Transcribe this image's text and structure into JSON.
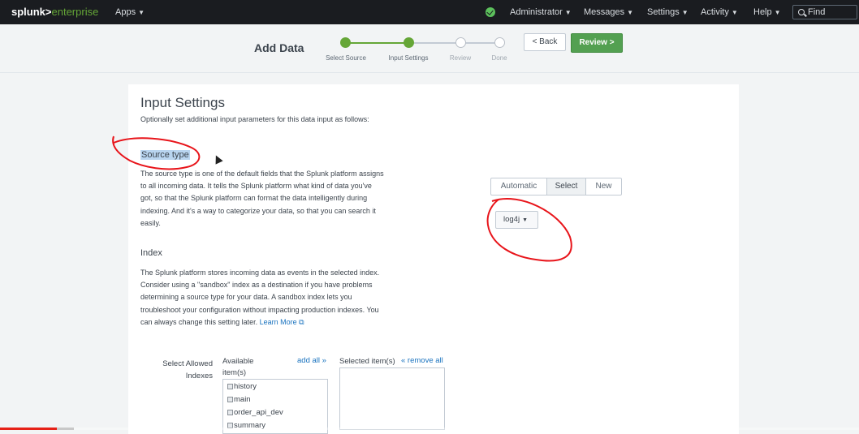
{
  "topbar": {
    "logo_main": "splunk>",
    "logo_sub": "enterprise",
    "apps": "Apps",
    "menu": [
      "Administrator",
      "Messages",
      "Settings",
      "Activity",
      "Help"
    ],
    "find_placeholder": "Find"
  },
  "wizard": {
    "title": "Add Data",
    "steps": [
      {
        "label": "Select Source",
        "state": "done"
      },
      {
        "label": "Input Settings",
        "state": "done"
      },
      {
        "label": "Review",
        "state": "todo"
      },
      {
        "label": "Done",
        "state": "todo"
      }
    ],
    "back_label": "< Back",
    "review_label": "Review >"
  },
  "main": {
    "heading": "Input Settings",
    "subheading": "Optionally set additional input parameters for this data input as follows:",
    "source_type": {
      "heading": "Source type",
      "description": "The source type is one of the default fields that the Splunk platform assigns to all incoming data. It tells the Splunk platform what kind of data you've got, so that the Splunk platform can format the data intelligently during indexing. And it's a way to categorize your data, so that you can search it easily.",
      "modes": [
        "Automatic",
        "Select",
        "New"
      ],
      "active_mode": "Select",
      "selected_value": "log4j"
    },
    "index": {
      "heading": "Index",
      "description": "The Splunk platform stores incoming data as events in the selected index. Consider using a \"sandbox\" index as a destination if you have problems determining a source type for your data. A sandbox index lets you troubleshoot your configuration without impacting production indexes. You can always change this setting later.",
      "learn_more": "Learn More",
      "select_label": "Select Allowed Indexes",
      "available_header": "Available item(s)",
      "add_all": "add all »",
      "selected_header": "Selected item(s)",
      "remove_all": "« remove all",
      "available_items": [
        "history",
        "main",
        "order_api_dev",
        "summary"
      ]
    }
  },
  "colors": {
    "accent_green": "#65a637",
    "link_blue": "#1a73bf",
    "annotation_red": "#e8141a",
    "highlight": "#b9d5f0"
  },
  "video_progress": {
    "played": 0.066,
    "buffered": 0.086
  }
}
